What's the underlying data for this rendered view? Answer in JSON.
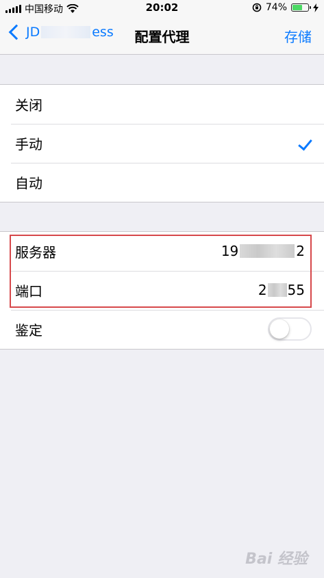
{
  "status": {
    "carrier": "中国移动",
    "time": "20:02",
    "battery_text": "74%",
    "battery_level": 0.74,
    "battery_color": "#4cd964"
  },
  "nav": {
    "back_prefix": "JD",
    "back_suffix": "ess",
    "title": "配置代理",
    "save": "存储"
  },
  "mode_options": [
    {
      "label": "关闭",
      "selected": false
    },
    {
      "label": "手动",
      "selected": true
    },
    {
      "label": "自动",
      "selected": false
    }
  ],
  "proxy": {
    "server_label": "服务器",
    "server_value_start": "19",
    "server_value_end": "2",
    "port_label": "端口",
    "port_value_start": "2",
    "port_value_end": "55",
    "auth_label": "鉴定",
    "auth_enabled": false
  },
  "accent_color": "#0a7aff",
  "highlight_color": "#d6474a",
  "watermark": "Bai 经验",
  "icons": [
    "signal-icon",
    "wifi-icon",
    "lock-rotation-icon",
    "battery-icon",
    "charging-icon",
    "chevron-left-icon",
    "checkmark-icon"
  ]
}
